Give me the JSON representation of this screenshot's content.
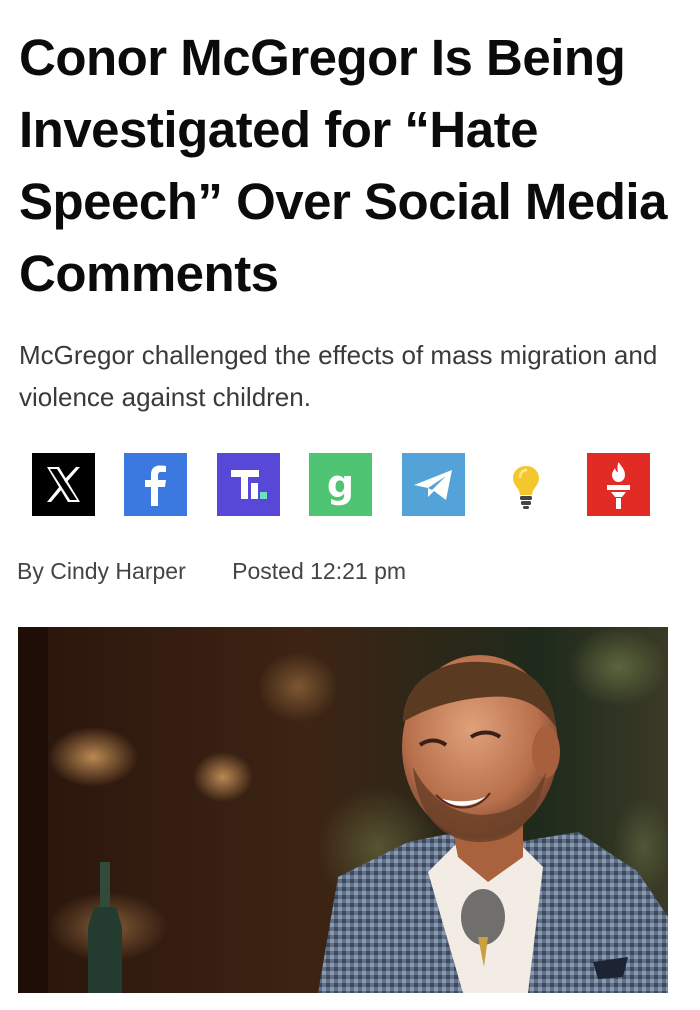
{
  "article": {
    "headline": "Conor McGregor Is Being Investigated for “Hate Speech” Over Social Media Comments",
    "subheadline": "McGregor challenged the effects of mass migration and violence against children.",
    "byline": "By Cindy Harper",
    "posted": "Posted 12:21 pm"
  },
  "share": {
    "buttons": [
      {
        "name": "x",
        "icon": "x-logo-icon",
        "color": "#000000"
      },
      {
        "name": "facebook",
        "icon": "facebook-icon",
        "color": "#3b79e0"
      },
      {
        "name": "truth-social",
        "icon": "truth-social-icon",
        "color": "#5848d8"
      },
      {
        "name": "gettr",
        "icon": "gettr-icon",
        "color": "#4fc472"
      },
      {
        "name": "telegram",
        "icon": "telegram-icon",
        "color": "#53a3d9"
      },
      {
        "name": "idea",
        "icon": "lightbulb-icon",
        "color": "#f4c72e"
      },
      {
        "name": "freedom-torch",
        "icon": "torch-icon",
        "color": "#e32b25"
      }
    ]
  },
  "hero_image": {
    "subject": "photo-of-smiling-man-in-checked-blazer"
  }
}
